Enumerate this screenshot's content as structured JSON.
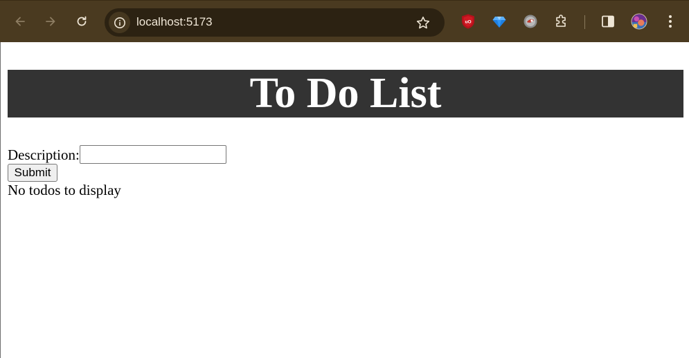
{
  "browser": {
    "url": "localhost:5173",
    "toolbar_color": "#4a3a20",
    "omnibox_color": "#2c2212",
    "icons": {
      "back": "back-arrow-icon",
      "forward": "forward-arrow-icon",
      "reload": "reload-icon",
      "site_info": "info-icon",
      "bookmark": "star-icon",
      "ext_ublock": "ublock-origin-icon",
      "ext_gem": "gem-icon",
      "ext_circle": "extension-circle-icon",
      "extensions": "puzzle-icon",
      "side_panel": "side-panel-icon",
      "profile": "avatar",
      "menu": "kebab-menu-icon"
    }
  },
  "app": {
    "title": "To Do List",
    "header_color": "#333333",
    "form": {
      "description_label": "Description:",
      "description_value": "",
      "submit_label": "Submit"
    },
    "empty_message": "No todos to display"
  }
}
